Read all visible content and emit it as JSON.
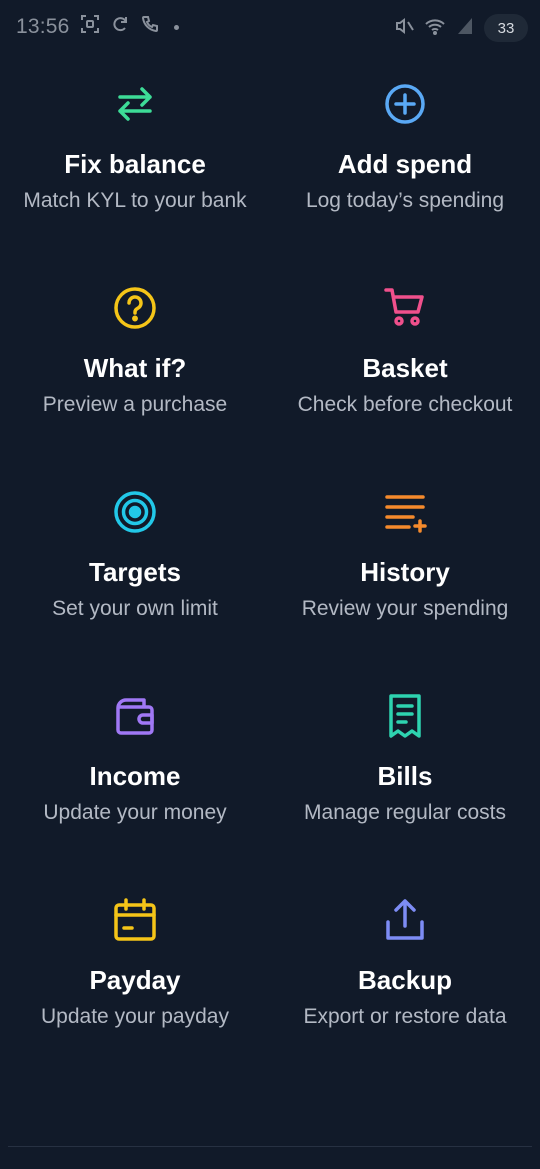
{
  "status_bar": {
    "time": "13:56",
    "battery": "33"
  },
  "tiles": [
    {
      "title": "Fix balance",
      "subtitle": "Match KYL to your bank",
      "icon": "swap-arrows-icon",
      "color": "#3ddc97"
    },
    {
      "title": "Add spend",
      "subtitle": "Log today’s spending",
      "icon": "plus-circle-icon",
      "color": "#5aa9f5"
    },
    {
      "title": "What if?",
      "subtitle": "Preview a purchase",
      "icon": "question-circle-icon",
      "color": "#f5c518"
    },
    {
      "title": "Basket",
      "subtitle": "Check before checkout",
      "icon": "cart-icon",
      "color": "#f0508c"
    },
    {
      "title": "Targets",
      "subtitle": "Set your own limit",
      "icon": "target-icon",
      "color": "#22c8e8"
    },
    {
      "title": "History",
      "subtitle": "Review your spending",
      "icon": "list-icon",
      "color": "#f58a2c"
    },
    {
      "title": "Income",
      "subtitle": "Update your money",
      "icon": "wallet-icon",
      "color": "#a078f5"
    },
    {
      "title": "Bills",
      "subtitle": "Manage regular costs",
      "icon": "receipt-icon",
      "color": "#2ed3b0"
    },
    {
      "title": "Payday",
      "subtitle": "Update your payday",
      "icon": "calendar-icon",
      "color": "#f5c518"
    },
    {
      "title": "Backup",
      "subtitle": "Export or restore data",
      "icon": "upload-icon",
      "color": "#7d8cf5"
    }
  ]
}
